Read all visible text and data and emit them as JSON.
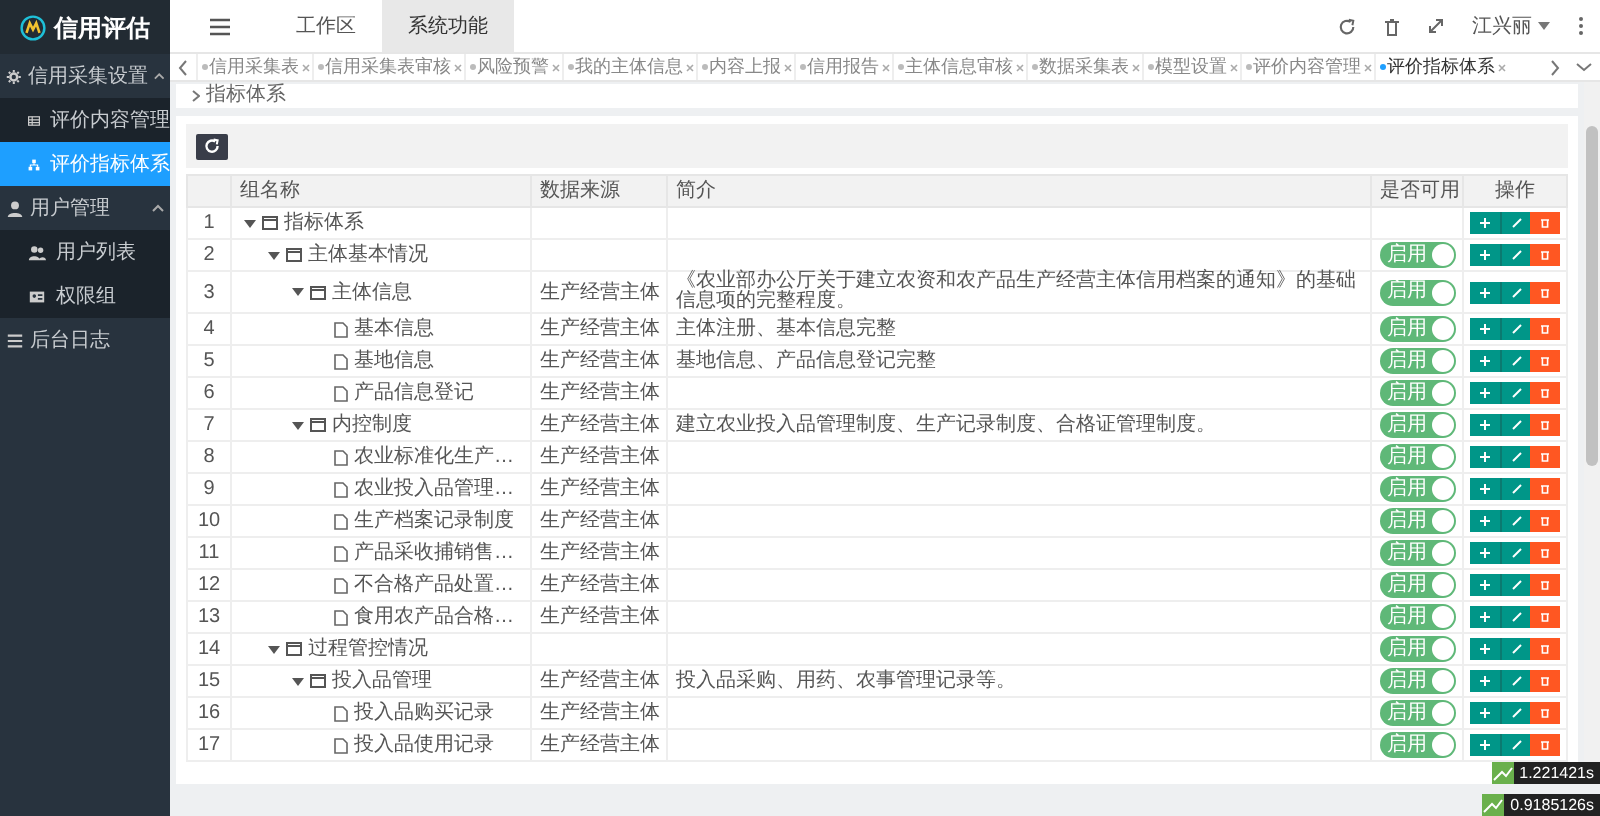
{
  "sidebar": {
    "logo": "信用评估",
    "items": [
      {
        "label": "信用采集设置",
        "expanded": true,
        "selected": false,
        "children": [
          {
            "label": "评价内容管理",
            "selected": false
          },
          {
            "label": "评价指标体系",
            "selected": true
          }
        ]
      },
      {
        "label": "用户管理",
        "expanded": true,
        "selected": false,
        "children": [
          {
            "label": "用户列表",
            "selected": false
          },
          {
            "label": "权限组",
            "selected": false
          }
        ]
      },
      {
        "label": "后台日志",
        "selected": false
      }
    ]
  },
  "top_nav": [
    {
      "label": "工作区",
      "selected": false
    },
    {
      "label": "系统功能",
      "selected": true
    }
  ],
  "user": {
    "name": "江兴丽"
  },
  "tabs": [
    {
      "label": "信用采集表",
      "selected": false
    },
    {
      "label": "信用采集表审核",
      "selected": false
    },
    {
      "label": "风险预警",
      "selected": false
    },
    {
      "label": "我的主体信息",
      "selected": false
    },
    {
      "label": "内容上报",
      "selected": false
    },
    {
      "label": "信用报告",
      "selected": false
    },
    {
      "label": "主体信息审核",
      "selected": false
    },
    {
      "label": "数据采集表",
      "selected": false
    },
    {
      "label": "模型设置",
      "selected": false
    },
    {
      "label": "评价内容管理",
      "selected": false
    },
    {
      "label": "评价指标体系",
      "selected": true
    }
  ],
  "breadcrumb": "指标体系",
  "table": {
    "columns": [
      "组名称",
      "数据来源",
      "简介",
      "是否可用",
      "操作"
    ],
    "rows": [
      {
        "number": "1",
        "name": "指标体系",
        "kind": "folder",
        "expanded": true,
        "children": [
          {
            "number": "2",
            "name": "主体基本情况",
            "kind": "folder",
            "expanded": true,
            "toggle": {
              "label": "启用",
              "on": true
            },
            "children": [
              {
                "number": "3",
                "name": "主体信息",
                "kind": "folder",
                "expanded": true,
                "source": "生产经营主体",
                "intro": "《农业部办公厅关于建立农资和农产品生产经营主体信用档案的通知》的基础信息项的完整程度。",
                "toggle": {
                  "label": "启用",
                  "on": true
                },
                "children": [
                  {
                    "number": "4",
                    "name": "基本信息",
                    "kind": "file",
                    "source": "生产经营主体",
                    "intro": "主体注册、基本信息完整",
                    "toggle": {
                      "label": "启用",
                      "on": true
                    }
                  },
                  {
                    "number": "5",
                    "name": "基地信息",
                    "kind": "file",
                    "source": "生产经营主体",
                    "intro": "基地信息、产品信息登记完整",
                    "toggle": {
                      "label": "启用",
                      "on": true
                    }
                  },
                  {
                    "number": "6",
                    "name": "产品信息登记",
                    "kind": "file",
                    "source": "生产经营主体",
                    "toggle": {
                      "label": "启用",
                      "on": true
                    }
                  }
                ]
              },
              {
                "number": "7",
                "name": "内控制度",
                "kind": "folder",
                "expanded": true,
                "source": "生产经营主体",
                "intro": "建立农业投入品管理制度、生产记录制度、合格证管理制度。",
                "toggle": {
                  "label": "启用",
                  "on": true
                },
                "children": [
                  {
                    "number": "8",
                    "name": "农业标准化生产…",
                    "kind": "file",
                    "source": "生产经营主体",
                    "toggle": {
                      "label": "启用",
                      "on": true
                    }
                  },
                  {
                    "number": "9",
                    "name": "农业投入品管理…",
                    "kind": "file",
                    "source": "生产经营主体",
                    "toggle": {
                      "label": "启用",
                      "on": true
                    }
                  },
                  {
                    "number": "10",
                    "name": "生产档案记录制度",
                    "kind": "file",
                    "source": "生产经营主体",
                    "toggle": {
                      "label": "启用",
                      "on": true
                    }
                  },
                  {
                    "number": "11",
                    "name": "产品采收捕销售…",
                    "kind": "file",
                    "source": "生产经营主体",
                    "toggle": {
                      "label": "启用",
                      "on": true
                    }
                  },
                  {
                    "number": "12",
                    "name": "不合格产品处置…",
                    "kind": "file",
                    "source": "生产经营主体",
                    "toggle": {
                      "label": "启用",
                      "on": true
                    }
                  },
                  {
                    "number": "13",
                    "name": "食用农产品合格…",
                    "kind": "file",
                    "source": "生产经营主体",
                    "toggle": {
                      "label": "启用",
                      "on": true
                    }
                  }
                ]
              }
            ]
          },
          {
            "number": "14",
            "name": "过程管控情况",
            "kind": "folder",
            "expanded": true,
            "toggle": {
              "label": "启用",
              "on": true
            },
            "children": [
              {
                "number": "15",
                "name": "投入品管理",
                "kind": "folder",
                "expanded": true,
                "source": "生产经营主体",
                "intro": "投入品采购、用药、农事管理记录等。",
                "toggle": {
                  "label": "启用",
                  "on": true
                },
                "children": [
                  {
                    "number": "16",
                    "name": "投入品购买记录",
                    "kind": "file",
                    "source": "生产经营主体",
                    "toggle": {
                      "label": "启用",
                      "on": true
                    }
                  },
                  {
                    "number": "17",
                    "name": "投入品使用记录",
                    "kind": "file",
                    "source": "生产经营主体",
                    "toggle": {
                      "label": "启用",
                      "on": true
                    }
                  }
                ]
              }
            ]
          }
        ]
      }
    ]
  },
  "timers": [
    "1.221421s",
    "0.9185126s"
  ]
}
